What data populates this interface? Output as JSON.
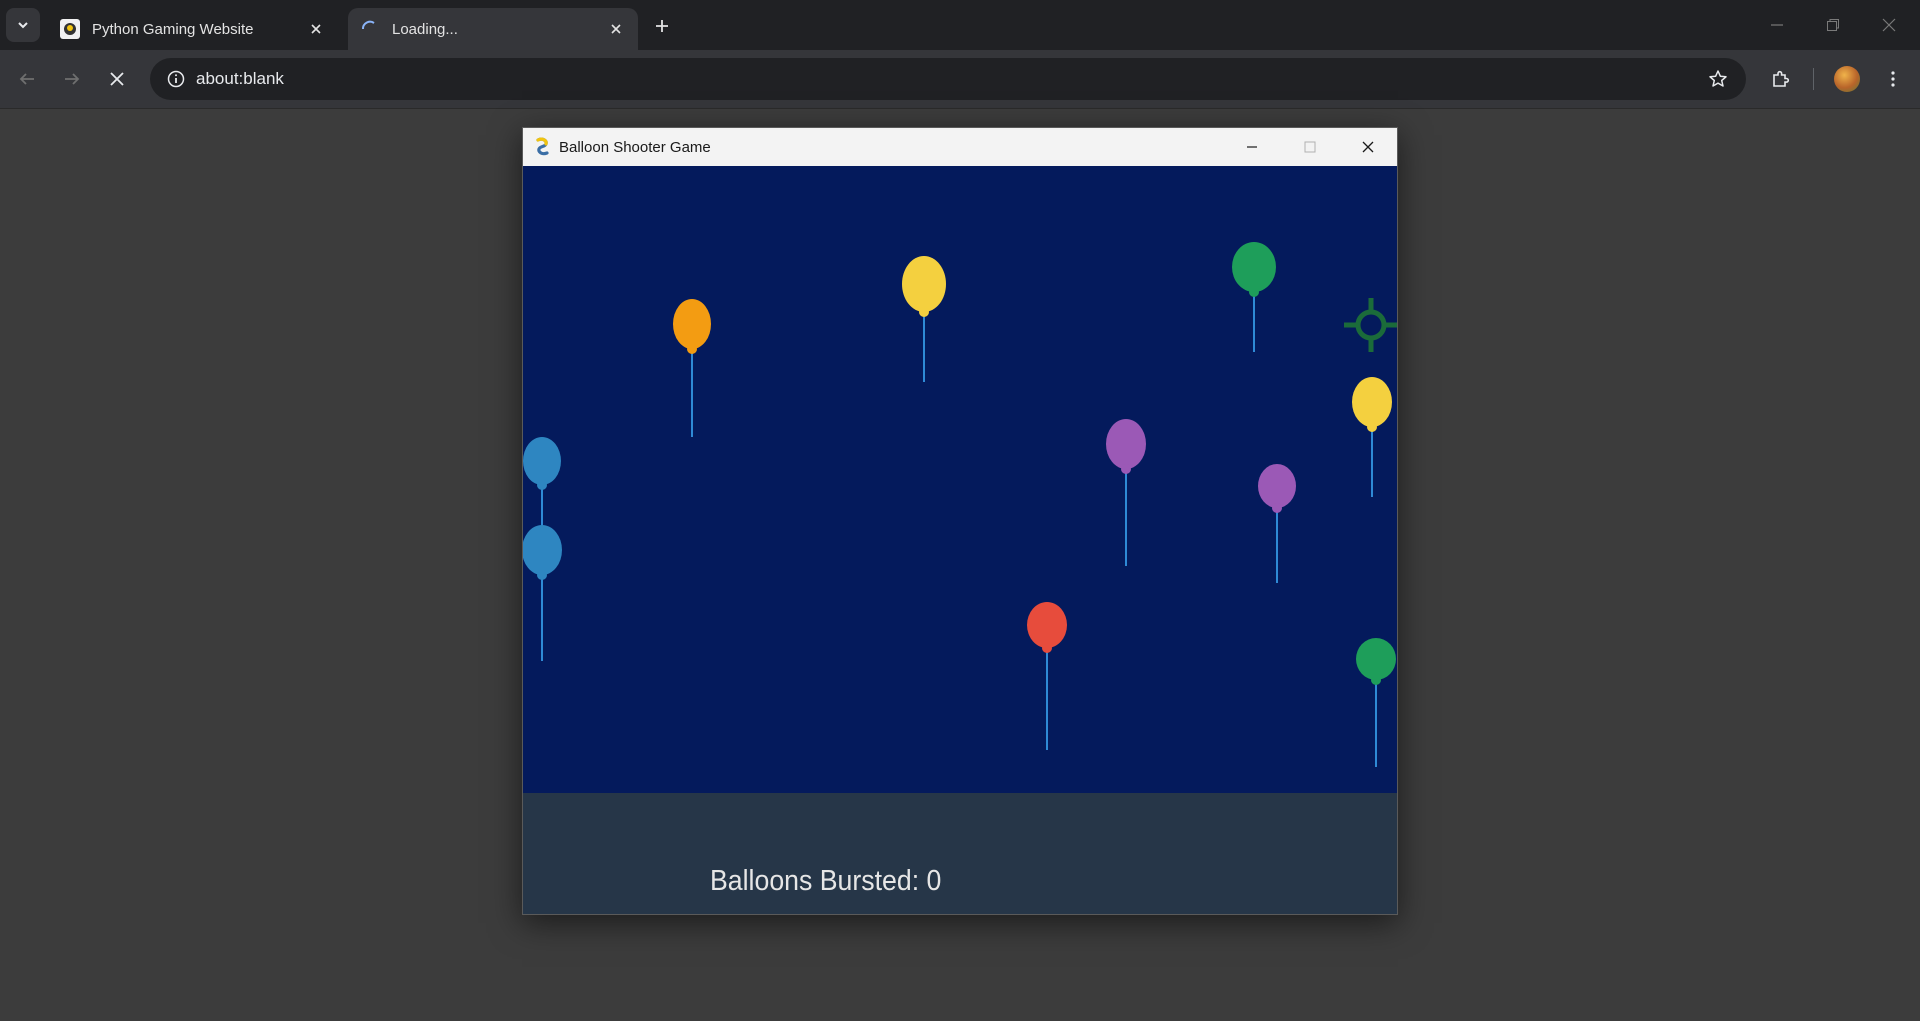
{
  "browser": {
    "tabs": [
      {
        "title": "Python Gaming Website",
        "state": "inactive",
        "icon": "pygame-favicon"
      },
      {
        "title": "Loading...",
        "state": "active",
        "icon": "loading-spinner-icon"
      }
    ],
    "address": "about:blank"
  },
  "game_window": {
    "title": "Balloon Shooter Game",
    "score_label": "Balloons Bursted: 0",
    "colors": {
      "sky": "#041a5c",
      "footer": "#263648",
      "crosshair": "#1b6b3a",
      "string": "#2f8ad6"
    },
    "balloons": [
      {
        "color": "orange",
        "hex": "#f39c12"
      },
      {
        "color": "yellow",
        "hex": "#f4d03f"
      },
      {
        "color": "green",
        "hex": "#1e9e5a"
      },
      {
        "color": "yellow",
        "hex": "#f4d03f"
      },
      {
        "color": "blue",
        "hex": "#2e86c1"
      },
      {
        "color": "blue",
        "hex": "#2e86c1"
      },
      {
        "color": "purple",
        "hex": "#9b59b6"
      },
      {
        "color": "purple",
        "hex": "#9b59b6"
      },
      {
        "color": "red",
        "hex": "#e74c3c"
      },
      {
        "color": "green",
        "hex": "#1e9e5a"
      }
    ]
  }
}
